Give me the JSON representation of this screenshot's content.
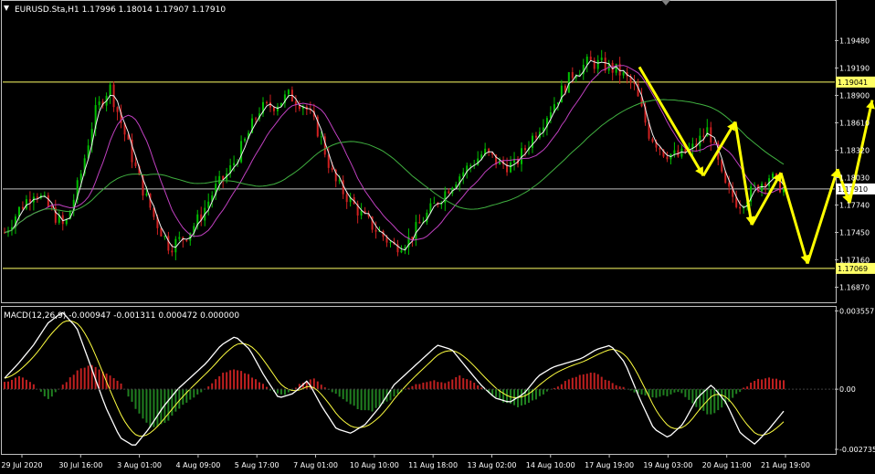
{
  "main_header": "EURUSD.Sta,H1  1.17996 1.18014 1.17907 1.17910",
  "macd_header": "MACD(12,26,9) -0.000947 -0.001311 0.000472 0.000000",
  "colors": {
    "background": "#000000",
    "frame": "#c0c0c0",
    "bull_candle": "#00c000",
    "bear_candle": "#d02020",
    "ma_fast": "#f0f0f0",
    "ma_mid": "#c040c0",
    "ma_slow": "#40b040",
    "resistance_line": "#ffff66",
    "current_line": "#c0c0c0",
    "arrows": "#ffff00",
    "macd_signal": "#ffff40",
    "macd_pos": "#c02020",
    "macd_neg": "#208020"
  },
  "chart_data": [
    {
      "type": "candlestick",
      "symbol": "EURUSD.Sta",
      "timeframe": "H1",
      "ohlc_last": {
        "open": 1.17996,
        "high": 1.18014,
        "low": 1.17907,
        "close": 1.1791
      },
      "price_axis_ticks": [
        "1.19480",
        "1.19190",
        "1.18900",
        "1.18610",
        "1.18320",
        "1.18030",
        "1.17740",
        "1.17450",
        "1.17160",
        "1.16870"
      ],
      "ylim": [
        1.1672,
        1.1989
      ],
      "highlighted_levels": [
        {
          "label": "1.19041",
          "value": 1.19041,
          "kind": "horizontal-line"
        },
        {
          "label": "1.17910",
          "value": 1.1791,
          "kind": "current-price"
        },
        {
          "label": "1.17069",
          "value": 1.17069,
          "kind": "horizontal-line"
        }
      ],
      "time_axis_labels": [
        "29 Jul 2020",
        "30 Jul 16:00",
        "3 Aug 01:00",
        "4 Aug 09:00",
        "5 Aug 17:00",
        "7 Aug 01:00",
        "10 Aug 10:00",
        "11 Aug 18:00",
        "13 Aug 02:00",
        "14 Aug 10:00",
        "17 Aug 19:00",
        "19 Aug 03:00",
        "20 Aug 11:00",
        "21 Aug 19:00"
      ],
      "close_path": [
        1.1745,
        1.177,
        1.179,
        1.177,
        1.175,
        1.18,
        1.187,
        1.19,
        1.185,
        1.18,
        1.176,
        1.173,
        1.174,
        1.176,
        1.179,
        1.181,
        1.184,
        1.1875,
        1.188,
        1.189,
        1.188,
        1.185,
        1.18,
        1.178,
        1.176,
        1.1745,
        1.173,
        1.1738,
        1.176,
        1.178,
        1.18,
        1.1815,
        1.183,
        1.1818,
        1.1815,
        1.184,
        1.1865,
        1.189,
        1.1915,
        1.1925,
        1.1922,
        1.1915,
        1.19,
        1.185,
        1.183,
        1.1825,
        1.1835,
        1.1855,
        1.1795,
        1.1775,
        1.179,
        1.1805,
        1.1791
      ],
      "arrow_path": [
        [
          1.192,
          "17 Aug 19:00"
        ],
        [
          1.1805,
          "19 Aug 03:00"
        ],
        [
          1.1862,
          "20 Aug 11:00"
        ],
        [
          1.1753,
          "20 Aug 11:00"
        ],
        [
          1.1808,
          "21 Aug 19:00"
        ],
        [
          1.1712,
          ""
        ],
        [
          1.1812,
          ""
        ],
        [
          1.1776,
          ""
        ],
        [
          1.1885,
          ""
        ]
      ]
    },
    {
      "type": "histogram",
      "name": "MACD(12,26,9)",
      "values": {
        "main": -0.000947,
        "signal": -0.001311,
        "histogram": 0.000472,
        "level": 0.0
      },
      "axis_ticks": [
        "0.003557",
        "0.00",
        "-0.002735"
      ],
      "ylim": [
        -0.0029,
        0.0037
      ],
      "histogram_path": [
        0.0003,
        0.0006,
        0.0002,
        -0.0005,
        0.0002,
        0.0009,
        0.0011,
        0.0007,
        0.0002,
        -0.001,
        -0.0018,
        -0.0015,
        -0.0008,
        -0.0003,
        0.0002,
        0.0008,
        0.0009,
        0.0005,
        0.0,
        -0.0003,
        0.0002,
        0.0005,
        0.0,
        -0.0004,
        -0.0009,
        -0.001,
        -0.0006,
        -0.0001,
        0.0002,
        0.0004,
        0.0003,
        0.0006,
        0.0003,
        -0.0002,
        -0.0006,
        -0.0008,
        -0.0005,
        -0.0001,
        0.0003,
        0.0006,
        0.0008,
        0.0004,
        0.0001,
        -0.0002,
        -0.0004,
        -0.0003,
        -0.0001,
        -0.0008,
        -0.0012,
        -0.0007,
        -0.0001,
        0.0004,
        0.0005,
        0.0004
      ],
      "macd_path": [
        0.0005,
        0.0012,
        0.002,
        0.003,
        0.0035,
        0.0028,
        0.001,
        -0.0008,
        -0.0022,
        -0.0026,
        -0.0018,
        -0.0008,
        0.0,
        0.0006,
        0.0012,
        0.002,
        0.0024,
        0.0018,
        0.0006,
        -0.0004,
        -0.0002,
        0.0004,
        -0.0008,
        -0.0018,
        -0.002,
        -0.0016,
        -0.0008,
        0.0002,
        0.0008,
        0.0014,
        0.002,
        0.0018,
        0.001,
        0.0002,
        -0.0004,
        -0.0006,
        -0.0002,
        0.0006,
        0.001,
        0.0012,
        0.0014,
        0.0018,
        0.002,
        0.0012,
        -0.0004,
        -0.0018,
        -0.0022,
        -0.0016,
        -0.0004,
        0.0002,
        -0.0006,
        -0.002,
        -0.0025,
        -0.0018,
        -0.001
      ]
    }
  ]
}
